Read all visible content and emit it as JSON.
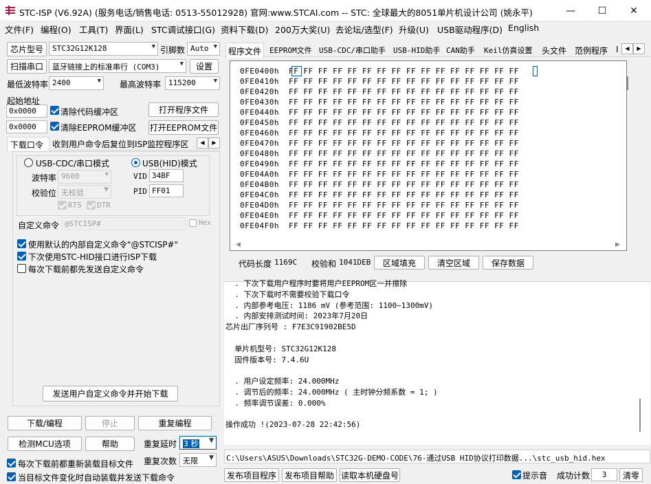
{
  "window": {
    "title": "STC-ISP (V6.92A) (服务电话/销售电话: 0513-55012928) 官网:www.STCAI.com  -- STC: 全球最大的8051单片机设计公司 (姚永平)",
    "minimize_glyph": "—",
    "maximize_glyph": "☐",
    "close_glyph": "✕"
  },
  "menu": [
    "文件(F)",
    "编程(O)",
    "工具(T)",
    "界面(L)",
    "STC调试接口(G)",
    "资料下载(D)",
    "200万大奖(U)",
    "去论坛/选型(F)",
    "升级(U)",
    "USB驱动程序(D)",
    "English"
  ],
  "left": {
    "chip_label": "芯片型号",
    "chip_value": "STC32G12K128",
    "pin_label": "引脚数",
    "pin_value": "Auto",
    "scan_button": "扫描串口",
    "port_value": "蓝牙链接上的标准串行 (COM3)",
    "settings_button": "设置",
    "min_baud_label": "最低波特率",
    "min_baud_value": "2400",
    "max_baud_label": "最高波特率",
    "max_baud_value": "115200",
    "start_addr_label": "起始地址",
    "code_addr": "0x0000",
    "clear_code_label": "清除代码缓冲区",
    "open_program_button": "打开程序文件",
    "eeprom_addr": "0x0000",
    "clear_eeprom_label": "清除EEPROM缓冲区",
    "open_eeprom_button": "打开EEPROM文件",
    "subtabs": [
      "下载口令",
      "收到用户命令后复位到ISP监控程序区"
    ],
    "usb_cdc_label": "USB-CDC/串口模式",
    "usb_hid_label": "USB(HID)模式",
    "baud_label": "波特率",
    "baud_value": "9600",
    "parity_label": "校验位",
    "parity_value": "无校验",
    "rts_label": "RTS",
    "dtr_label": "DTR",
    "vid_label": "VID",
    "vid_value": "34BF",
    "pid_label": "PID",
    "pid_value": "FF01",
    "custom_cmd_label": "自定义命令",
    "custom_cmd_value": "@STCISP#",
    "hex_label": "Hex",
    "opt1": "使用默认的内部自定义命令\"@STCISP#\"",
    "opt2": "下次使用STC-HID接口进行ISP下载",
    "opt3": "每次下载前都先发送自定义命令",
    "send_cmd_button": "发送用户自定义命令并开始下载",
    "download_button": "下载/编程",
    "stop_button": "停止",
    "reprogram_button": "重复编程",
    "check_mcu_button": "检测MCU选项",
    "help_button": "帮助",
    "repeat_delay_label": "重复延时",
    "repeat_delay_value": "3 秒",
    "repeat_count_label": "重复次数",
    "repeat_count_value": "无限",
    "reload_label": "每次下载前都重新装载目标文件",
    "auto_label": "当目标文件变化时自动装载并发送下载命令"
  },
  "right_tabs": [
    "程序文件",
    "EEPROM文件",
    "USB-CDC/串口助手",
    "USB-HID助手",
    "CAN助手",
    "Keil仿真设置",
    "头文件",
    "范例程序",
    "I"
  ],
  "hex": {
    "addresses": [
      "0FE0400h",
      "0FE0410h",
      "0FE0420h",
      "0FE0430h",
      "0FE0440h",
      "0FE0450h",
      "0FE0460h",
      "0FE0470h",
      "0FE0480h",
      "0FE0490h",
      "0FE04A0h",
      "0FE04B0h",
      "0FE04C0h",
      "0FE04D0h",
      "0FE04E0h",
      "0FE04F0h"
    ],
    "row_bytes": "FF FF FF FF FF FF FF FF FF FF FF FF FF FF FF FF"
  },
  "code_bar": {
    "length_label": "代码长度",
    "length_value": "1169C",
    "checksum_label": "校验和",
    "checksum_value": "1041DEB",
    "fill_button": "区域填充",
    "clear_button": "清空区域",
    "save_button": "保存数据"
  },
  "log": [
    "  . 下次下载用户程序时要将用户EEPROM区一并擦除",
    "  . 下次下载时不需要校验下载口令",
    "  . 内部参考电压: 1186 mV (参考范围: 1100~1300mV)",
    "  . 内部安排测试时间: 2023年7月20日",
    "芯片出厂序列号 : F7E3C91902BE5D",
    "",
    "  单片机型号: STC32G12K128",
    "  固件版本号: 7.4.6U",
    "",
    "  . 用户设定频率: 24.000MHz",
    "  . 调节后的频率: 24.000MHz ( 主时钟分频系数 = 1; )",
    "  . 频率调节误差: 0.000%",
    "",
    "操作成功 !(2023-07-28 22:42:56)"
  ],
  "path": "C:\\Users\\ASUS\\Downloads\\STC32G-DEMO-CODE\\76-通过USB HID协议打印数据...\\stc_usb_hid.hex",
  "bottom": {
    "publish_button": "发布项目程序",
    "publish_help_button": "发布项目帮助",
    "read_disk_button": "读取本机硬盘号",
    "sound_label": "提示音",
    "count_label": "成功计数",
    "count_value": "3",
    "clear_button": "清零"
  },
  "colors": {
    "accent": "#005fb8",
    "background": "#f0f0f0"
  }
}
